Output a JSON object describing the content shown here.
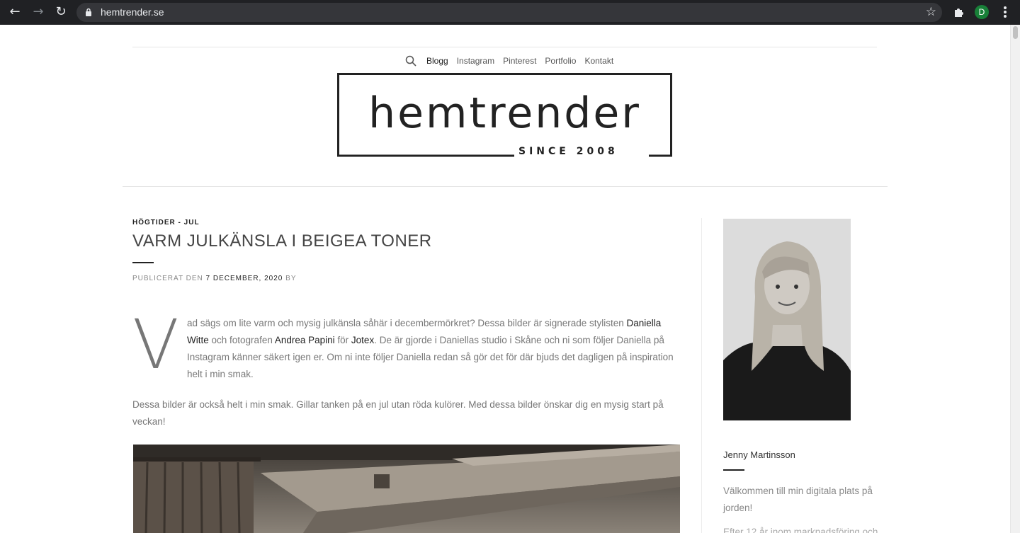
{
  "browser": {
    "url": "hemtrender.se",
    "profile_initial": "D"
  },
  "nav": {
    "items": [
      {
        "label": "Blogg"
      },
      {
        "label": "Instagram"
      },
      {
        "label": "Pinterest"
      },
      {
        "label": "Portfolio"
      },
      {
        "label": "Kontakt"
      }
    ]
  },
  "logo": {
    "name": "hemtrender",
    "tagline": "SINCE 2008"
  },
  "post": {
    "category": "HÖGTIDER - JUL",
    "title": "VARM JULKÄNSLA I BEIGEA TONER",
    "meta_prefix": "PUBLICERAT DEN",
    "date": "7 DECEMBER, 2020",
    "meta_suffix": "BY",
    "dropcap": "V",
    "p1_a": "ad sägs om lite varm och mysig julkänsla såhär i decembermörkret? Dessa bilder är signerade stylisten ",
    "p1_link1": "Daniella Witte",
    "p1_b": " och fotografen ",
    "p1_link2": "Andrea Papini",
    "p1_c": " för ",
    "p1_link3": "Jotex",
    "p1_d": ". De är gjorde i Daniellas studio i Skåne och ni som följer Daniella på Instagram känner säkert igen er. Om ni inte följer Daniella redan så gör det för där bjuds det dagligen på inspiration helt i min smak.",
    "p2": "Dessa bilder är också helt i min smak. Gillar tanken på en jul utan röda kulörer. Med dessa bilder önskar dig en mysig start på veckan!"
  },
  "sidebar": {
    "author_name": "Jenny Martinsson",
    "bio": "Välkommen till min digitala plats på jorden!",
    "bio_cut": "Efter 12 år inom marknadsföring och"
  },
  "colors": {
    "chrome_bg": "#202124",
    "omnibox_bg": "#35363a",
    "profile": "#188038",
    "text_body": "#777777",
    "text_link": "#222222"
  }
}
